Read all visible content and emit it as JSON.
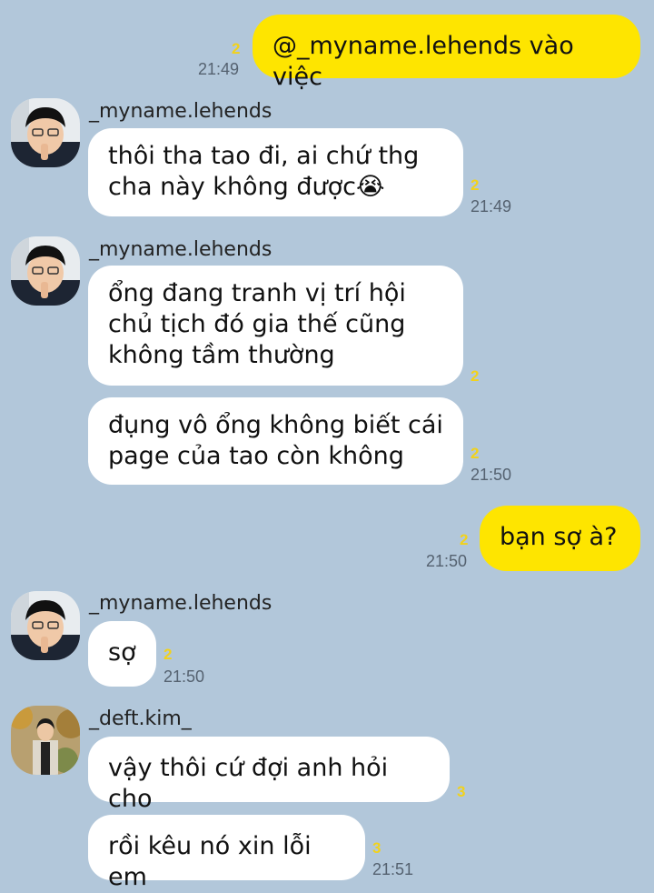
{
  "colors": {
    "background": "#b2c7da",
    "outgoing_bubble": "#fee500",
    "incoming_bubble": "#ffffff",
    "unread_count": "#f2d21b"
  },
  "messages": {
    "m1": {
      "text": "@_myname.lehends vào việc",
      "unread": "2",
      "time": "21:49"
    },
    "g1": {
      "sender": "_myname.lehends",
      "avatar": "avatar-lehends",
      "text": "thôi tha tao đi, ai chứ thg\ncha này không được😭",
      "unread": "2",
      "time": "21:49"
    },
    "g2": {
      "sender": "_myname.lehends",
      "avatar": "avatar-lehends",
      "a": {
        "text": "ổng đang tranh vị trí hội\nchủ tịch đó gia thế cũng\nkhông tầm thường",
        "unread": "2"
      },
      "b": {
        "text": "đụng vô ổng không biết cái\npage của tao còn không",
        "unread": "2",
        "time": "21:50"
      }
    },
    "m2": {
      "text": "bạn sợ à?",
      "unread": "2",
      "time": "21:50"
    },
    "g3": {
      "sender": "_myname.lehends",
      "avatar": "avatar-lehends",
      "text": "sợ",
      "unread": "2",
      "time": "21:50"
    },
    "g4": {
      "sender": "_deft.kim_",
      "avatar": "avatar-deft",
      "a": {
        "text": "vậy thôi cứ đợi anh hỏi cho",
        "unread": "3"
      },
      "b": {
        "text": "rồi kêu nó xin lỗi em",
        "unread": "3",
        "time": "21:51"
      }
    }
  }
}
